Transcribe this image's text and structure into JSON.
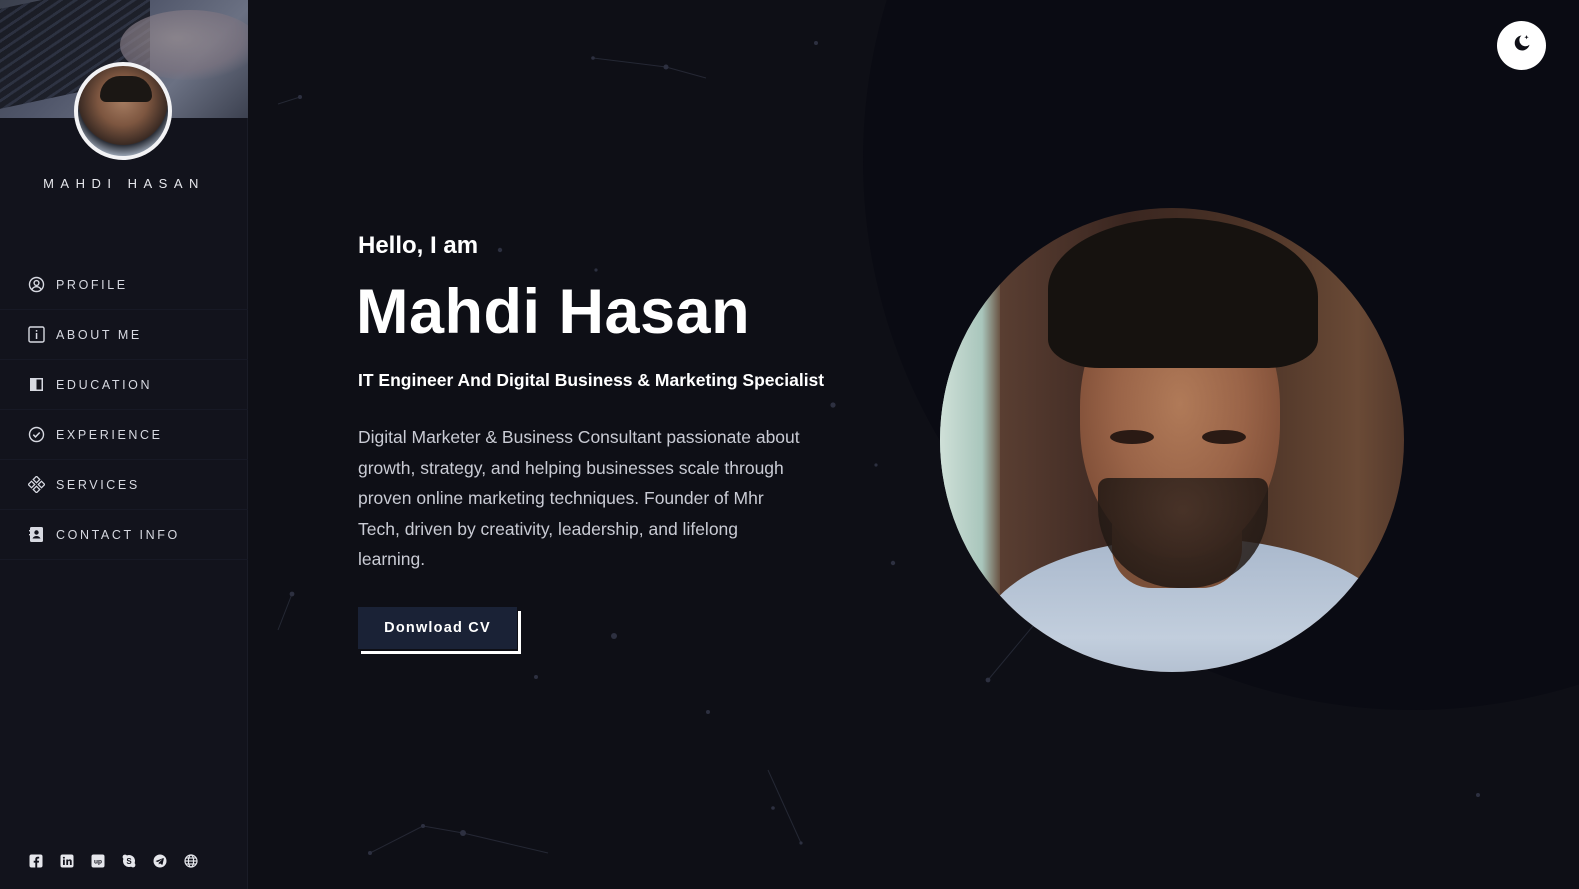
{
  "profile": {
    "name": "MAHDI HASAN"
  },
  "nav": {
    "items": [
      {
        "label": "PROFILE",
        "icon": "user-circle-icon"
      },
      {
        "label": "ABOUT ME",
        "icon": "info-icon"
      },
      {
        "label": "EDUCATION",
        "icon": "book-icon"
      },
      {
        "label": "EXPERIENCE",
        "icon": "check-circle-icon"
      },
      {
        "label": "SERVICES",
        "icon": "services-icon"
      },
      {
        "label": "CONTACT INFO",
        "icon": "contact-card-icon"
      }
    ]
  },
  "socials": [
    {
      "icon": "facebook-icon"
    },
    {
      "icon": "linkedin-icon"
    },
    {
      "icon": "upwork-icon"
    },
    {
      "icon": "skype-icon"
    },
    {
      "icon": "telegram-icon"
    },
    {
      "icon": "globe-icon"
    }
  ],
  "hero": {
    "greeting": "Hello, I am",
    "name": "Mahdi Hasan",
    "subtitle": "IT Engineer And Digital Business & Marketing Specialist",
    "bio": "Digital Marketer & Business Consultant passionate about growth, strategy, and helping businesses scale through proven online marketing techniques. Founder of Mhr Tech, driven by creativity, leadership, and lifelong learning.",
    "cv_button": "Donwload CV"
  },
  "theme_toggle": {
    "icon": "moon-star-icon"
  },
  "colors": {
    "background": "#0e0f16",
    "sidebar": "#12131c",
    "button": "#1a2236",
    "text": "#ffffff"
  }
}
